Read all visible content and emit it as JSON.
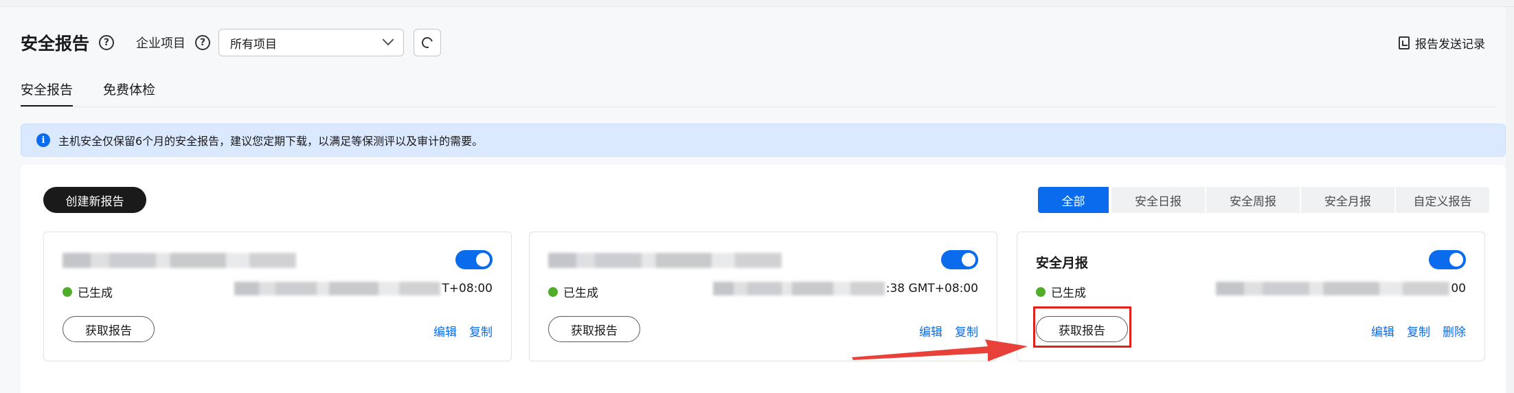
{
  "header": {
    "title": "安全报告",
    "project_label": "企业项目",
    "project_select_value": "所有项目",
    "send_log_label": "报告发送记录"
  },
  "tabs": [
    {
      "label": "安全报告",
      "active": true
    },
    {
      "label": "免费体检",
      "active": false
    }
  ],
  "notice": {
    "text": "主机安全仅保留6个月的安全报告，建议您定期下载，以满足等保测评以及审计的需要。"
  },
  "toolbar": {
    "create_label": "创建新报告",
    "filters": [
      "全部",
      "安全日报",
      "安全周报",
      "安全月报",
      "自定义报告"
    ],
    "active_filter": "全部"
  },
  "cards": [
    {
      "name": "",
      "enabled": true,
      "status": "已生成",
      "time_suffix": "T+08:00",
      "get_label": "获取报告",
      "actions": [
        "编辑",
        "复制"
      ]
    },
    {
      "name": "",
      "enabled": true,
      "status": "已生成",
      "time_suffix": ":38 GMT+08:00",
      "get_label": "获取报告",
      "actions": [
        "编辑",
        "复制"
      ]
    },
    {
      "name": "安全月报",
      "enabled": true,
      "status": "已生成",
      "time_suffix": "00",
      "get_label": "获取报告",
      "actions": [
        "编辑",
        "复制",
        "删除"
      ]
    }
  ],
  "colors": {
    "accent": "#0a6ced",
    "success": "#4fad29",
    "highlight": "#e3201c",
    "create_button": "#1a1a1a"
  }
}
